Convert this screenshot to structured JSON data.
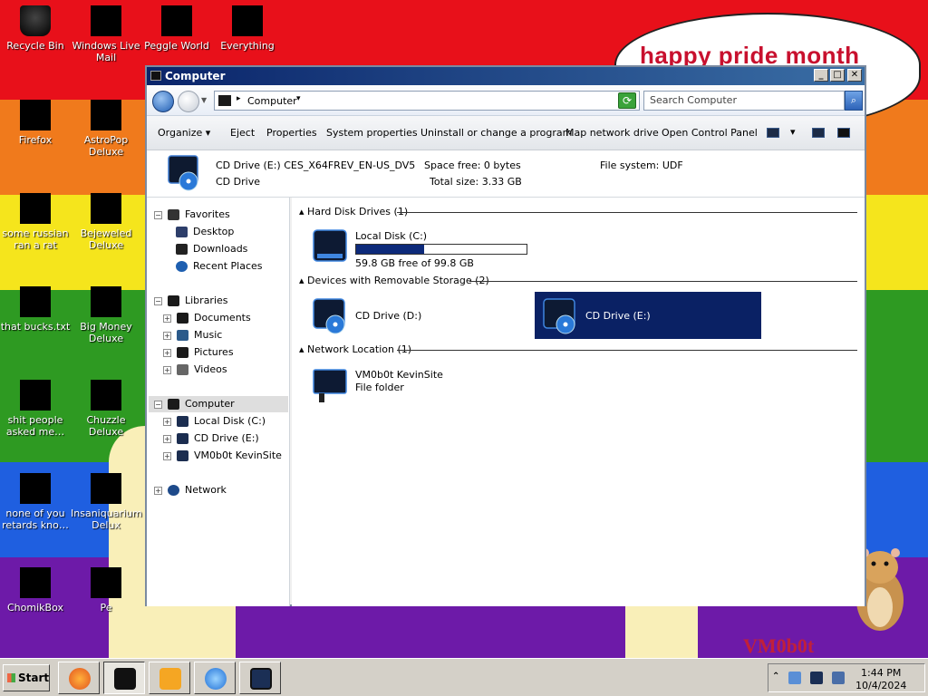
{
  "desktop": {
    "bubble_text": "happy pride month",
    "logo_text": "VM0b0t",
    "icons": [
      {
        "label": "Recycle Bin"
      },
      {
        "label": "Windows Live Mail"
      },
      {
        "label": "Peggle World"
      },
      {
        "label": "Everything"
      },
      {
        "label": "Firefox"
      },
      {
        "label": "AstroPop Deluxe"
      },
      {
        "label": "some russian ran a rat"
      },
      {
        "label": "Bejeweled Deluxe"
      },
      {
        "label": "that bucks.txt"
      },
      {
        "label": "Big Money Deluxe"
      },
      {
        "label": "shit people asked me…"
      },
      {
        "label": "Chuzzle Deluxe"
      },
      {
        "label": "none of you retards kno…"
      },
      {
        "label": "Insaniquarium Delux"
      },
      {
        "label": "ChomikBox"
      },
      {
        "label": "Pe"
      }
    ]
  },
  "window": {
    "title": "Computer",
    "address": {
      "location": "Computer"
    },
    "search": {
      "placeholder": "Search Computer"
    },
    "toolbar": {
      "organize": "Organize",
      "eject": "Eject",
      "properties": "Properties",
      "system_properties": "System properties",
      "uninstall": "Uninstall or change a program",
      "map_drive": "Map network drive",
      "control_panel": "Open Control Panel"
    },
    "details": {
      "name": "CD Drive (E:) CES_X64FREV_EN-US_DV5",
      "type": "CD Drive",
      "space_free": "Space free: 0 bytes",
      "total_size": "Total size: 3.33 GB",
      "file_system": "File system: UDF"
    },
    "nav": {
      "favorites": "Favorites",
      "desktop": "Desktop",
      "downloads": "Downloads",
      "recent_places": "Recent Places",
      "libraries": "Libraries",
      "documents": "Documents",
      "music": "Music",
      "pictures": "Pictures",
      "videos": "Videos",
      "computer": "Computer",
      "local_disk": "Local Disk (C:)",
      "cd_drive_e": "CD Drive (E:)",
      "kevinsite": "VM0b0t KevinSite",
      "network": "Network"
    },
    "content": {
      "groups": {
        "hdd": "Hard Disk Drives (1)",
        "removable": "Devices with Removable Storage (2)",
        "network": "Network Location (1)"
      },
      "local_disk": {
        "name": "Local Disk (C:)",
        "free": "59.8 GB free of 99.8 GB",
        "used_fraction": 0.4
      },
      "cd_d": {
        "name": "CD Drive (D:)"
      },
      "cd_e": {
        "name": "CD Drive (E:)"
      },
      "netloc": {
        "name": "VM0b0t KevinSite",
        "type": "File folder"
      }
    }
  },
  "taskbar": {
    "start": "Start",
    "time": "1:44 PM",
    "date": "10/4/2024"
  }
}
